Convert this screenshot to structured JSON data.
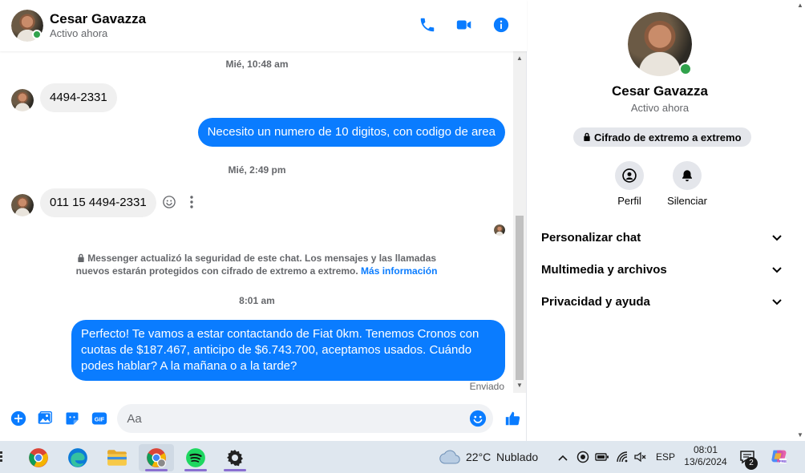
{
  "header": {
    "contact_name": "Cesar Gavazza",
    "status": "Activo ahora",
    "icons": [
      "phone-icon",
      "video-icon",
      "info-icon"
    ]
  },
  "conversation": {
    "ts1": "Mié, 10:48 am",
    "msg1": "4494-2331",
    "msg2": "Necesito un numero de 10 digitos, con codigo de area",
    "ts2": "Mié, 2:49 pm",
    "msg3": "011 15 4494-2331",
    "security_note": "Messenger actualizó la seguridad de este chat. Los mensajes y las llamadas nuevos estarán protegidos con cifrado de extremo a extremo.",
    "security_link": "Más información",
    "ts3": "8:01 am",
    "msg4": "Perfecto! Te vamos a estar contactando de Fiat 0km. Tenemos Cronos con cuotas de $187.467, anticipo de $6.743.700, aceptamos usados. Cuándo podes hablar? A la mañana o a la tarde?",
    "sent_label": "Enviado"
  },
  "composer": {
    "placeholder": "Aa"
  },
  "sidebar": {
    "name": "Cesar Gavazza",
    "status": "Activo ahora",
    "e2e_label": "Cifrado de extremo a extremo",
    "profile_label": "Perfil",
    "mute_label": "Silenciar",
    "sections": [
      "Personalizar chat",
      "Multimedia y archivos",
      "Privacidad y ayuda"
    ]
  },
  "taskbar": {
    "temperature": "22°C",
    "weather": "Nublado",
    "language": "ESP",
    "time": "08:01",
    "date": "13/6/2024",
    "notifications": "2"
  },
  "colors": {
    "accent": "#0a7cff",
    "online": "#31a24c",
    "incoming_bubble": "#f0f0f0"
  }
}
